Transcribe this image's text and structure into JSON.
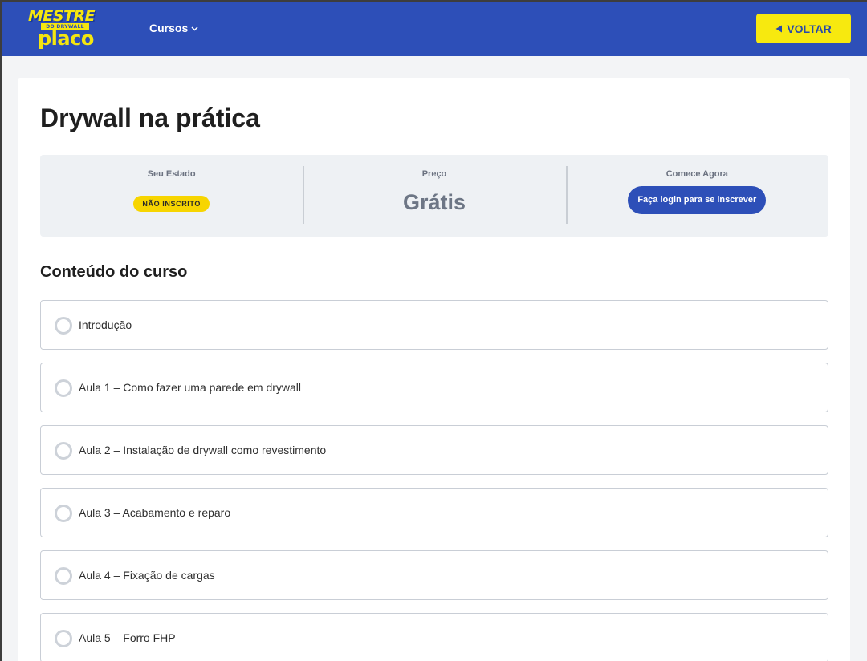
{
  "header": {
    "logo": {
      "line1": "MESTRE",
      "line2": "DO DRYWALL",
      "line3": "placo"
    },
    "nav_cursos": "Cursos",
    "voltar_label": "VOLTAR"
  },
  "course": {
    "title": "Drywall na prática",
    "status": {
      "estado_label": "Seu Estado",
      "estado_value": "NÃO INSCRITO",
      "preco_label": "Preço",
      "preco_value": "Grátis",
      "comece_label": "Comece Agora",
      "login_button": "Faça login para se inscrever"
    },
    "content_title": "Conteúdo do curso",
    "lessons": [
      "Introdução",
      "Aula 1 – Como fazer uma parede em drywall",
      "Aula 2 – Instalação de drywall como revestimento",
      "Aula 3 – Acabamento e reparo",
      "Aula 4 – Fixação de cargas",
      "Aula 5 – Forro FHP"
    ]
  },
  "colors": {
    "header_blue": "#2d4fb8",
    "brand_yellow": "#f7e90f",
    "badge_yellow": "#f7d500"
  }
}
